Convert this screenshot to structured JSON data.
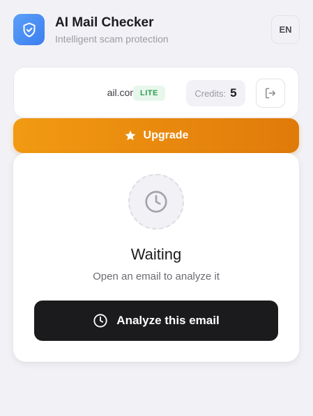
{
  "header": {
    "title": "AI Mail Checker",
    "subtitle": "Intelligent scam protection",
    "language": "EN",
    "logo_icon": "shield-check-icon"
  },
  "account": {
    "email": "ail.com",
    "plan": "LITE",
    "credits_label": "Credits:",
    "credits_value": "5",
    "logout_icon": "logout-icon"
  },
  "upgrade": {
    "label": "Upgrade",
    "icon": "star-icon"
  },
  "status": {
    "icon": "clock-icon",
    "title": "Waiting",
    "message": "Open an email to analyze it"
  },
  "analyze": {
    "label": "Analyze this email",
    "icon": "clock-icon"
  },
  "colors": {
    "brand_blue": "#3d7ef0",
    "upgrade_orange": "#f29a12",
    "plan_green": "#2f9e4f",
    "primary_dark": "#1b1b1d",
    "background": "#f2f2f6"
  }
}
